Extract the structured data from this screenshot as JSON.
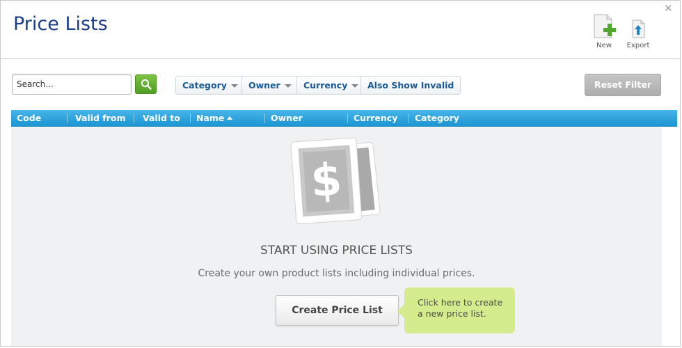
{
  "header": {
    "title": "Price Lists",
    "close_glyph": "✕",
    "actions": {
      "new_label": "New",
      "export_label": "Export"
    }
  },
  "toolbar": {
    "search_placeholder": "Search...",
    "filters": {
      "category": "Category",
      "owner": "Owner",
      "currency": "Currency",
      "also_show_invalid": "Also Show Invalid"
    },
    "reset_label": "Reset Filter"
  },
  "table": {
    "columns": [
      "Code",
      "Valid from",
      "Valid to",
      "Name",
      "Owner",
      "Currency",
      "Category"
    ],
    "sorted_column": "Name",
    "sort_direction": "asc"
  },
  "empty_state": {
    "title": "START USING PRICE LISTS",
    "description": "Create your own product lists including individual prices.",
    "create_label": "Create Price List",
    "tooltip_line1": "Click here to create",
    "tooltip_line2": "a new price list."
  },
  "icons": {
    "new": "new-document-plus-icon",
    "export": "export-arrow-icon",
    "search": "magnifier-icon",
    "empty": "price-tag-dollar-icon"
  },
  "colors": {
    "title": "#1a3f88",
    "accent_green": "#5aa82a",
    "table_header": "#1c95d1",
    "tooltip": "#d5ec8e"
  }
}
